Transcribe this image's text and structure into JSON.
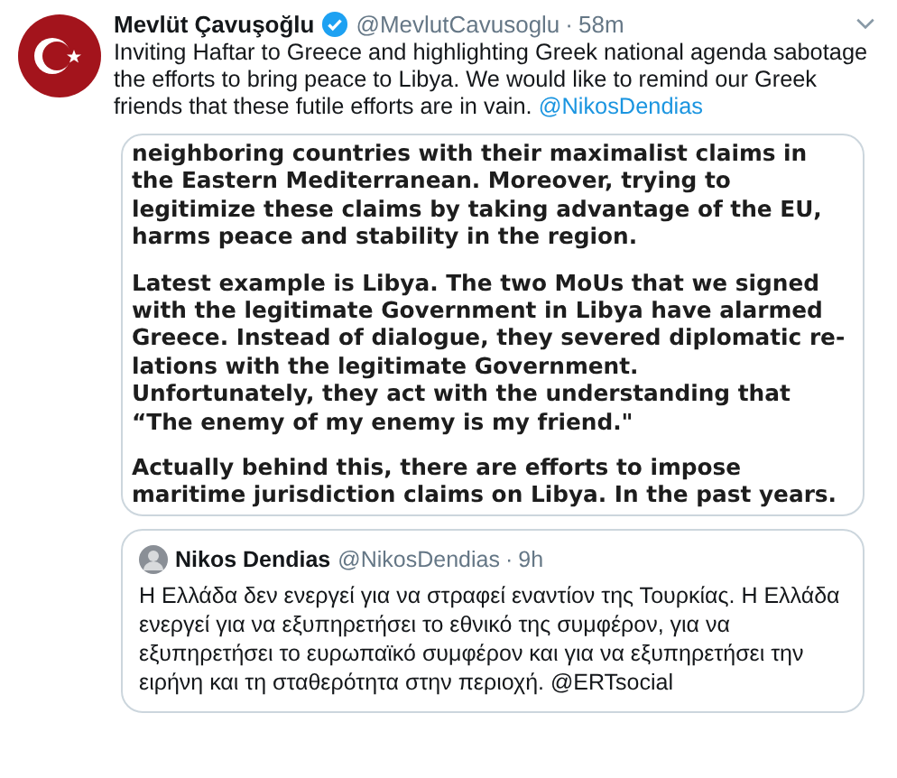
{
  "tweet": {
    "name": "Mevlüt Çavuşoğlu",
    "verified": true,
    "handle": "@MevlutCavusoglu",
    "separator": "·",
    "time": "58m",
    "text": "Inviting Haftar to Greece and highlighting Greek national agenda sabotage the efforts to bring peace to Libya. We would like to remind our Greek friends that these futile efforts are in vain.",
    "mention": "@NikosDendias",
    "image_paragraphs": [
      [
        "neighboring countries with their maximalist claims in",
        "the Eastern Mediterranean. Moreover, trying to",
        "legitimize these claims by taking advantage of the EU,",
        "harms peace and stability in the region."
      ],
      [
        "Latest example is Libya. The two MoUs that we signed",
        "with the legitimate Government in Libya have alarmed",
        "Greece. Instead of dialogue, they severed diplomatic re-",
        "lations with the legitimate Government.",
        "Unfortunately, they act with the understanding that",
        "“The enemy of my enemy is my friend.\""
      ],
      [
        "Actually behind this, there are efforts to impose",
        "maritime jurisdiction claims on Libya. In the past years."
      ]
    ],
    "quoted": {
      "name": "Nikos Dendias",
      "handle": "@NikosDendias",
      "separator": "·",
      "time": "9h",
      "text": "Η Ελλάδα δεν ενεργεί για να στραφεί εναντίον της Τουρκίας. Η Ελλάδα ενεργεί για να εξυπηρετήσει το εθνικό της συμφέρον, για να εξυπηρετήσει το ευρωπαϊκό συμφέρον και για να εξυπηρετήσει την ειρήνη και τη σταθερότητα στην περιοχή.",
      "mention": "@ERTsocial"
    }
  }
}
